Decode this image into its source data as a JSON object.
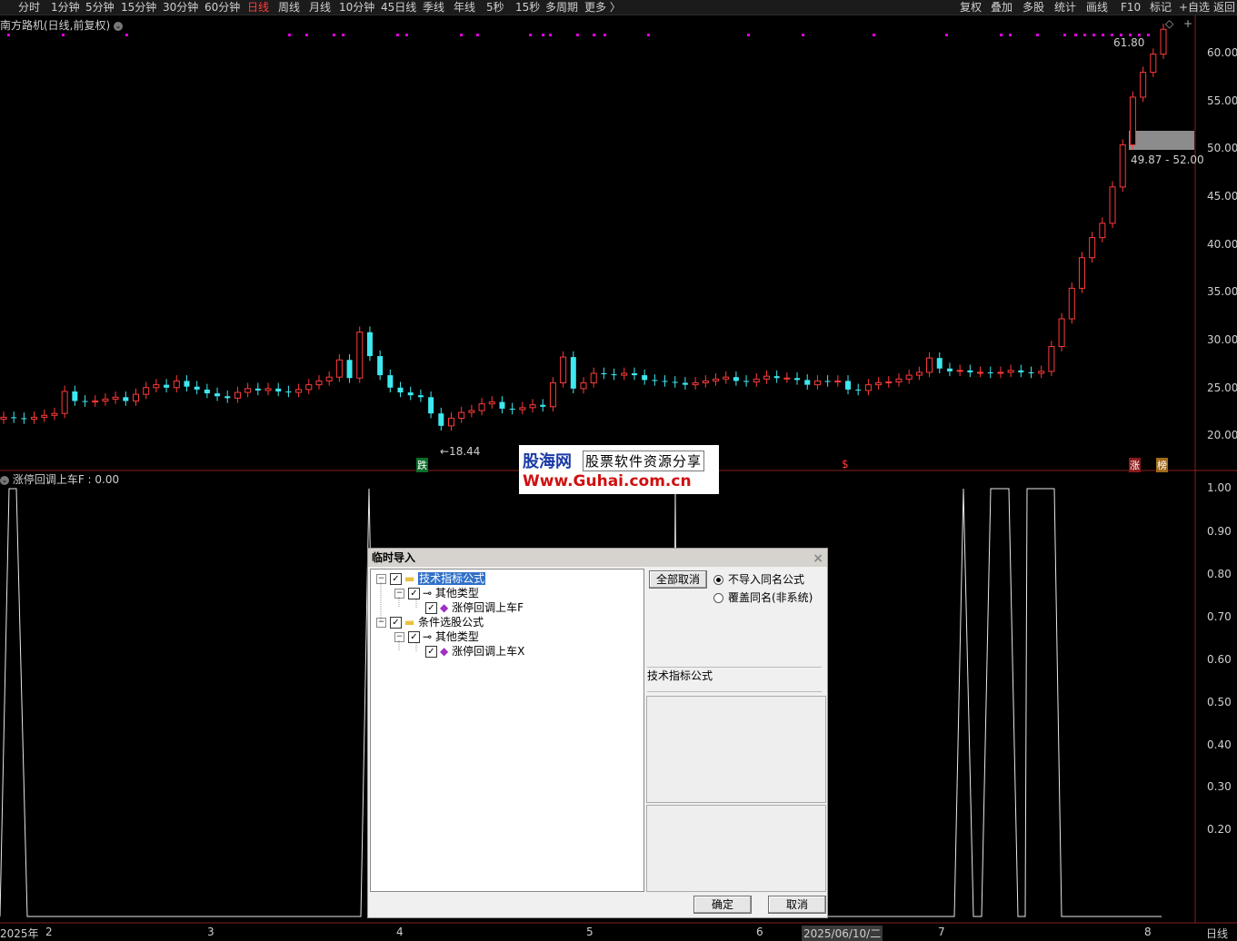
{
  "toolbar": {
    "tabs": [
      "分时",
      "1分钟",
      "5分钟",
      "15分钟",
      "30分钟",
      "60分钟",
      "日线",
      "周线",
      "月线",
      "10分钟",
      "45日线",
      "季线",
      "年线",
      "5秒",
      "15秒",
      "多周期",
      "更多 〉"
    ],
    "active_tab": "日线",
    "right_tools": [
      "复权",
      "叠加",
      "多股",
      "统计",
      "画线",
      "F10",
      "标记",
      "+自选",
      "返回"
    ]
  },
  "main_chart": {
    "title": "南方路机(日线,前复权)",
    "price_ticks": [
      "60.00",
      "55.00",
      "50.00",
      "45.00",
      "40.00",
      "35.00",
      "30.00",
      "25.00",
      "20.00"
    ],
    "high_label": "61.80",
    "low_label": "←18.44",
    "gap_label": "49.87 - 52.00",
    "markers": {
      "die": "跌",
      "s": "$",
      "zhang": "涨",
      "bang": "榜"
    }
  },
  "indicator": {
    "title": "涨停回调上车F : 0.00",
    "ticks": [
      "1.00",
      "0.90",
      "0.80",
      "0.70",
      "0.60",
      "0.50",
      "0.40",
      "0.30",
      "0.20"
    ]
  },
  "dates": {
    "labels": [
      "2025年",
      "2",
      "3",
      "4",
      "5",
      "6",
      "2025/06/10/二",
      "7",
      "8"
    ],
    "period": "日线"
  },
  "watermark": {
    "brand": "股海网",
    "slogan": "股票软件资源分享",
    "url": "Www.Guhai.com.cn"
  },
  "dialog": {
    "title": "临时导入",
    "close": "×",
    "tree": [
      {
        "label": "技术指标公式",
        "level": 0
      },
      {
        "label": "其他类型",
        "level": 1
      },
      {
        "label": "涨停回调上车F",
        "level": 2
      },
      {
        "label": "条件选股公式",
        "level": 0
      },
      {
        "label": "其他类型",
        "level": 1
      },
      {
        "label": "涨停回调上车X",
        "level": 2
      }
    ],
    "cancel_all": "全部取消",
    "option_skip": "不导入同名公式",
    "option_overwrite": "覆盖同名(非系统)",
    "info_label": "技术指标公式",
    "ok": "确定",
    "cancel": "取消"
  },
  "colors": {
    "up": "#ff3b3b",
    "down": "#3ee8f0",
    "bg": "#000000",
    "marker": "#e000e0"
  }
}
